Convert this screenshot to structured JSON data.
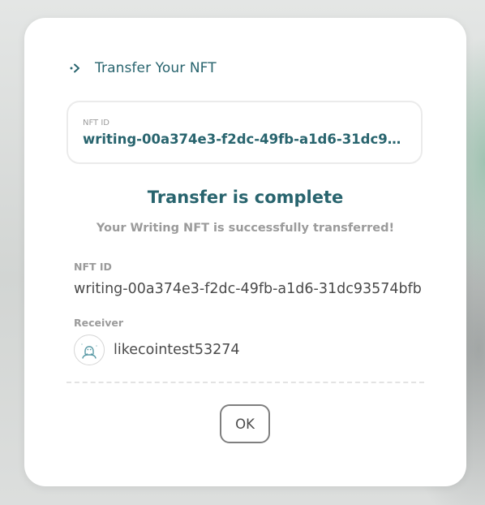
{
  "modal": {
    "title": "Transfer Your NFT",
    "nft_field": {
      "caption": "NFT ID",
      "value": "writing-00a374e3-f2dc-49fb-a1d6-31dc93574bfb"
    },
    "status_title": "Transfer is complete",
    "status_subtitle": "Your Writing NFT is successfully transferred!",
    "details": {
      "nft_id_label": "NFT ID",
      "nft_id_value": "writing-00a374e3-f2dc-49fb-a1d6-31dc93574bfb",
      "receiver_label": "Receiver",
      "receiver_name": "likecointest53274"
    },
    "ok_label": "OK"
  },
  "icons": {
    "header": "arrow-right-icon",
    "avatar": "user-avatar-icon"
  },
  "colors": {
    "accent": "#28646e",
    "muted_text": "#9b9b9b",
    "body_text": "#4a4a4a"
  }
}
